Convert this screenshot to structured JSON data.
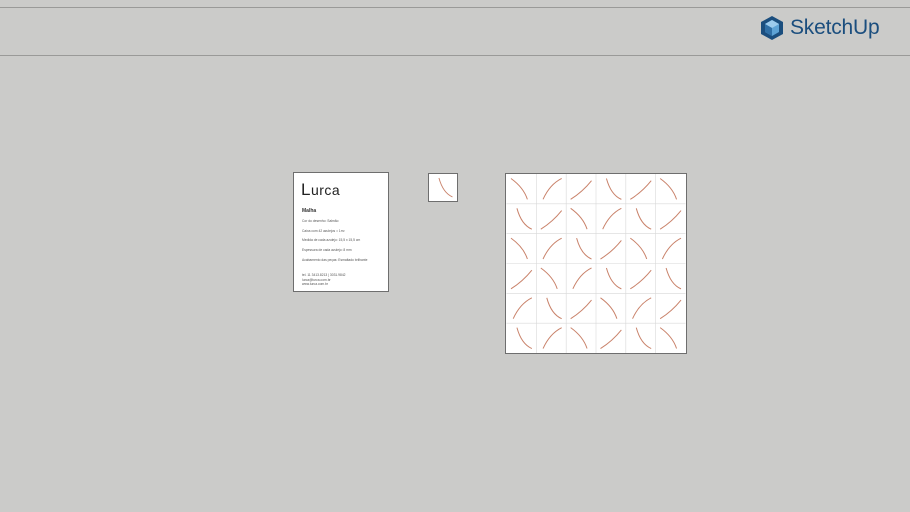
{
  "app": {
    "logo_text": "SketchUp",
    "logo_icon": "sketchup-cube-icon",
    "brand_color": "#1b4e7e"
  },
  "card": {
    "brand": "Lurca",
    "product_name": "Malha",
    "specs": [
      "Cor do desenho: Salmão",
      "Caixa com 42 azulejos = 1m²",
      "Medida de cada azulejo: 15,5 x 15,5 cm",
      "Espessura de cada azulejo: 8 mm",
      "Acabamento das peças: Esmaltado brilhante"
    ],
    "contact": [
      "tel. 11 3413.8213 | 3031.9842",
      "lurca@lurca.com.br",
      "www.lurca.com.br"
    ]
  },
  "tile": {
    "line_color": "#c9826a",
    "grid_line_color": "#d8d8d8"
  },
  "pattern": {
    "rows": 6,
    "cols": 6,
    "arcs": [
      [
        0,
        1,
        2,
        3,
        2,
        0
      ],
      [
        3,
        2,
        0,
        1,
        3,
        2
      ],
      [
        0,
        1,
        3,
        2,
        0,
        1
      ],
      [
        2,
        0,
        1,
        3,
        2,
        3
      ],
      [
        1,
        3,
        2,
        0,
        1,
        2
      ],
      [
        3,
        1,
        0,
        2,
        3,
        0
      ]
    ]
  }
}
